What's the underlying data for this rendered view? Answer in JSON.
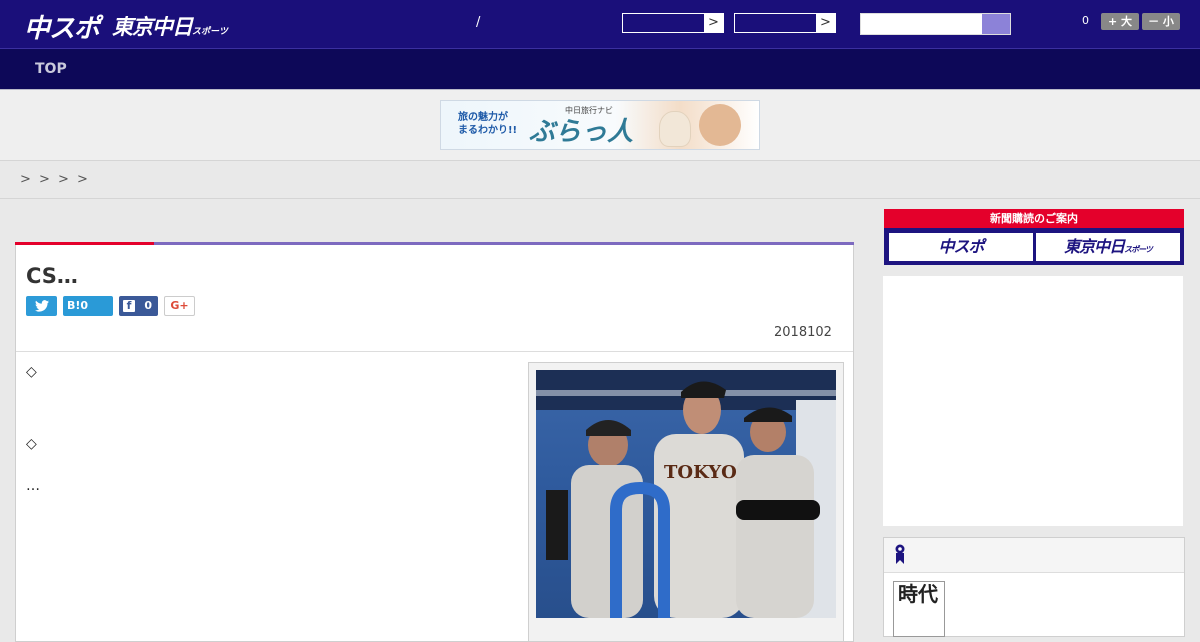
{
  "header": {
    "logo_chuspo": "中スポ",
    "logo_tokyo": "東京中日",
    "logo_tokyo_sub": "スポーツ",
    "separator": "/",
    "dropdown_arrow": ">",
    "font_count": "0",
    "font_up": "+ 大",
    "font_down": "－ 小"
  },
  "nav": {
    "top": "TOP"
  },
  "banner": {
    "line1": "旅の魅力が",
    "line2": "まるわかり!!",
    "small": "中日旅行ナビ",
    "brand": "ぶらっ人"
  },
  "breadcrumb": [
    ">",
    ">",
    ">",
    ">"
  ],
  "article": {
    "title": "CS…",
    "share": {
      "hatena_label": "B!",
      "hatena_count": "0",
      "facebook_count": "0",
      "google_plus": "G+"
    },
    "date": "2018102",
    "body": [
      "◇",
      "◇",
      "…"
    ],
    "photo_jersey_text": "TOKYO"
  },
  "sidebar": {
    "newspaper_head": "新聞購読のご案内",
    "newspaper_a": "中スポ",
    "newspaper_b": "東京中日",
    "newspaper_b_sub": "スポーツ",
    "book_title": "時代"
  },
  "colors": {
    "header": "#1a0f7a",
    "nav": "#0d0858",
    "accent_red": "#e4002b",
    "accent_purple": "#7d6ac0"
  }
}
